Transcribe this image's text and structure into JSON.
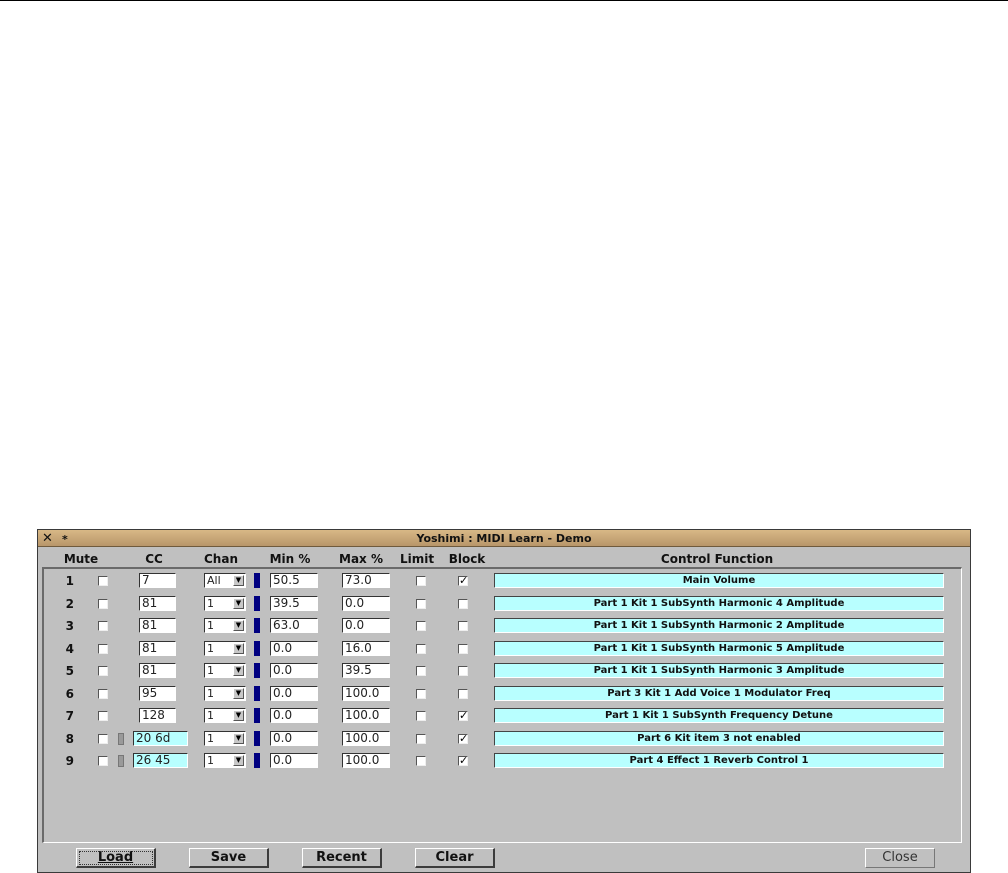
{
  "window": {
    "title": "Yoshimi : MIDI Learn - Demo",
    "close_glyph": "✕",
    "pin_glyph": "*"
  },
  "headers": {
    "mute": "Mute",
    "cc": "CC",
    "chan": "Chan",
    "min": "Min %",
    "max": "Max %",
    "limit": "Limit",
    "block": "Block",
    "function": "Control Function"
  },
  "rows": [
    {
      "num": "1",
      "mute": false,
      "marker": false,
      "cc": "7",
      "chan": "All",
      "min": "50.5",
      "max": "73.0",
      "limit": false,
      "block": true,
      "function": "Main Volume"
    },
    {
      "num": "2",
      "mute": false,
      "marker": false,
      "cc": "81",
      "chan": "1",
      "min": "39.5",
      "max": "0.0",
      "limit": false,
      "block": false,
      "function": "Part 1 Kit 1 SubSynth Harmonic 4 Amplitude"
    },
    {
      "num": "3",
      "mute": false,
      "marker": false,
      "cc": "81",
      "chan": "1",
      "min": "63.0",
      "max": "0.0",
      "limit": false,
      "block": false,
      "function": "Part 1 Kit 1 SubSynth Harmonic 2 Amplitude"
    },
    {
      "num": "4",
      "mute": false,
      "marker": false,
      "cc": "81",
      "chan": "1",
      "min": "0.0",
      "max": "16.0",
      "limit": false,
      "block": false,
      "function": "Part 1 Kit 1 SubSynth Harmonic 5 Amplitude"
    },
    {
      "num": "5",
      "mute": false,
      "marker": false,
      "cc": "81",
      "chan": "1",
      "min": "0.0",
      "max": "39.5",
      "limit": false,
      "block": false,
      "function": "Part 1 Kit 1 SubSynth Harmonic 3 Amplitude"
    },
    {
      "num": "6",
      "mute": false,
      "marker": false,
      "cc": "95",
      "chan": "1",
      "min": "0.0",
      "max": "100.0",
      "limit": false,
      "block": false,
      "function": "Part 3 Kit 1 Add Voice 1 Modulator Freq"
    },
    {
      "num": "7",
      "mute": false,
      "marker": false,
      "cc": "128",
      "chan": "1",
      "min": "0.0",
      "max": "100.0",
      "limit": false,
      "block": true,
      "function": "Part 1 Kit 1 SubSynth  Frequency Detune"
    },
    {
      "num": "8",
      "mute": false,
      "marker": true,
      "cc": "20 6d",
      "chan": "1",
      "min": "0.0",
      "max": "100.0",
      "limit": false,
      "block": true,
      "function": "Part 6 Kit item 3 not enabled"
    },
    {
      "num": "9",
      "mute": false,
      "marker": true,
      "cc": "26 45",
      "chan": "1",
      "min": "0.0",
      "max": "100.0",
      "limit": false,
      "block": true,
      "function": "Part 4 Effect 1 Reverb Control 1"
    }
  ],
  "buttons": {
    "load": "Load",
    "save": "Save",
    "recent": "Recent",
    "clear": "Clear",
    "close": "Close"
  },
  "colors": {
    "titlebar": "#c9a676",
    "function_bg": "#b8ffff",
    "channel_bar": "#000080"
  }
}
